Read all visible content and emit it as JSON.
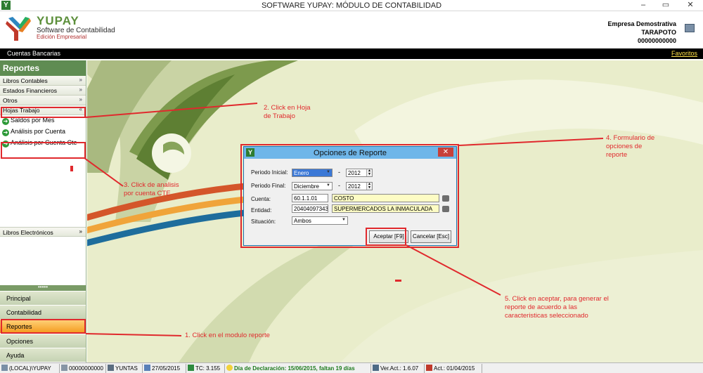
{
  "window": {
    "title": "SOFTWARE YUPAY: MÓDULO DE CONTABILIDAD",
    "minimize": "–",
    "maximize": "▭",
    "close": "✕"
  },
  "header": {
    "brand": "YUPAY",
    "subtitle": "Software de Contabilidad",
    "edition": "Edición Empresarial",
    "company_name": "Empresa Demostrativa",
    "company_city": "TARAPOTO",
    "company_ruc": "00000000000"
  },
  "navbar": {
    "breadcrumb": "Cuentas Bancarias",
    "favorites": "Favoritos"
  },
  "sidebar": {
    "title": "Reportes",
    "groups": [
      {
        "label": "Libros Contables",
        "chevron": "»"
      },
      {
        "label": "Estados Financieros",
        "chevron": "»"
      },
      {
        "label": "Otros",
        "chevron": "»"
      },
      {
        "label": "Hojas Trabajo",
        "chevron": "«"
      }
    ],
    "items": [
      {
        "label": "Saldos por Mes"
      },
      {
        "label": "Análisis por Cuenta"
      },
      {
        "label": "Análisis por Cuenta Cte"
      }
    ],
    "electronic": {
      "label": "Libros Electrónicos",
      "chevron": "»"
    },
    "dots": "•••••",
    "modules": [
      "Principal",
      "Contabilidad",
      "Reportes",
      "Opciones",
      "Ayuda"
    ],
    "active_module": "Reportes"
  },
  "dialog": {
    "title": "Opciones de Reporte",
    "close": "✕",
    "periodo_inicial_label": "Periodo Inicial:",
    "periodo_inicial_month": "Enero",
    "periodo_inicial_year": "2012",
    "periodo_final_label": "Periodo Final:",
    "periodo_final_month": "Diciembre",
    "periodo_final_year": "2012",
    "dash": "-",
    "cuenta_label": "Cuenta:",
    "cuenta_code": "60.1.1.01",
    "cuenta_name": "COSTO",
    "entidad_label": "Entidad:",
    "entidad_code": "20404097343",
    "entidad_name": "SUPERMERCADOS LA INMACULADA",
    "situacion_label": "Situación:",
    "situacion_value": "Ambos",
    "accept_button": "Aceptar [F9]",
    "cancel_button": "Cancelar [Esc]"
  },
  "annotations": {
    "step1": "1. Click en el modulo reporte",
    "step2_line1": "2. Click en Hoja",
    "step2_line2": "de Trabajo",
    "step3_line1": "3. Click de analisis",
    "step3_line2": "por cuenta CTE",
    "step4_line1": "4. Formulario de",
    "step4_line2": "opciones de",
    "step4_line3": "reporte",
    "step5_line1": "5. Click en aceptar, para generar el",
    "step5_line2": "reporte de acuerdo a las",
    "step5_line3": "caracteristicas seleccionado"
  },
  "statusbar": {
    "server": "(LOCAL)\\YUPAY",
    "ruc": "00000000000",
    "user": "YUNTAS",
    "date": "27/05/2015",
    "tc": "TC: 3.155",
    "declaration": "Día de Declaración: 15/06/2015, faltan 19 días",
    "version": "Ver.Act.: 1.6.07",
    "update": "Act.: 01/04/2015"
  },
  "colors": {
    "accent_green": "#5f8c52",
    "dialog_title": "#6fb6e9",
    "annotation_red": "#e0292d",
    "active_module": "#f49b1e"
  }
}
